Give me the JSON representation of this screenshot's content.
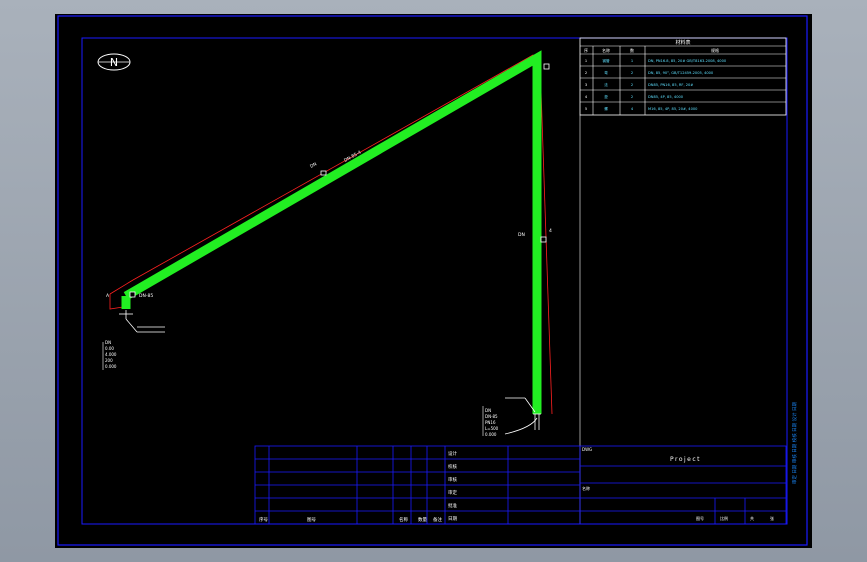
{
  "compass": {
    "label": "N"
  },
  "pipe_labels": {
    "diagonal_a": "DN",
    "diagonal_b": "DN-85-4",
    "vertical_a": "DN",
    "vertical_b": "4",
    "corner": "DN-85",
    "left_edge": "A"
  },
  "bottom_right_note": [
    "DN",
    "DN-85",
    "PN16",
    "L=500",
    "0.000"
  ],
  "bottom_left_note": [
    "DN",
    "0.00",
    "4.000",
    "200",
    "0.000"
  ],
  "material_table": {
    "title": "材料表",
    "headers": [
      "序",
      "名称",
      "数",
      "规格"
    ],
    "rows": [
      {
        "no": "1",
        "name": "钢管",
        "qty": "1",
        "spec": "DN, PN16.8, 85, 20# GB/T8163-2008, 4000"
      },
      {
        "no": "2",
        "name": "弯",
        "qty": "2",
        "spec": "DN, 85, 90°, GB/T12459-2005, 4000"
      },
      {
        "no": "3",
        "name": "法",
        "qty": "2",
        "spec": "DN85, PN16, 85, RF, 20#"
      },
      {
        "no": "4",
        "name": "垫",
        "qty": "2",
        "spec": "DN85, 4P, 85, 4000"
      },
      {
        "no": "5",
        "name": "螺",
        "qty": "4",
        "spec": "M16, 85, 4P, 85, 20#, 4000"
      }
    ]
  },
  "title_block": {
    "project": "Project",
    "drawing_no": "DWG",
    "roles": [
      "设计",
      "校核",
      "审核",
      "审定",
      "批准",
      "日期"
    ],
    "left_footer": [
      "序号",
      "图号",
      "名称",
      "数量",
      "备注"
    ],
    "sheet_info": [
      "图号",
      "比例",
      "共",
      "张"
    ],
    "code_label": "名称"
  },
  "side_strip_text": "审定 日期 审核 日期 校核 日期 设计 日期"
}
